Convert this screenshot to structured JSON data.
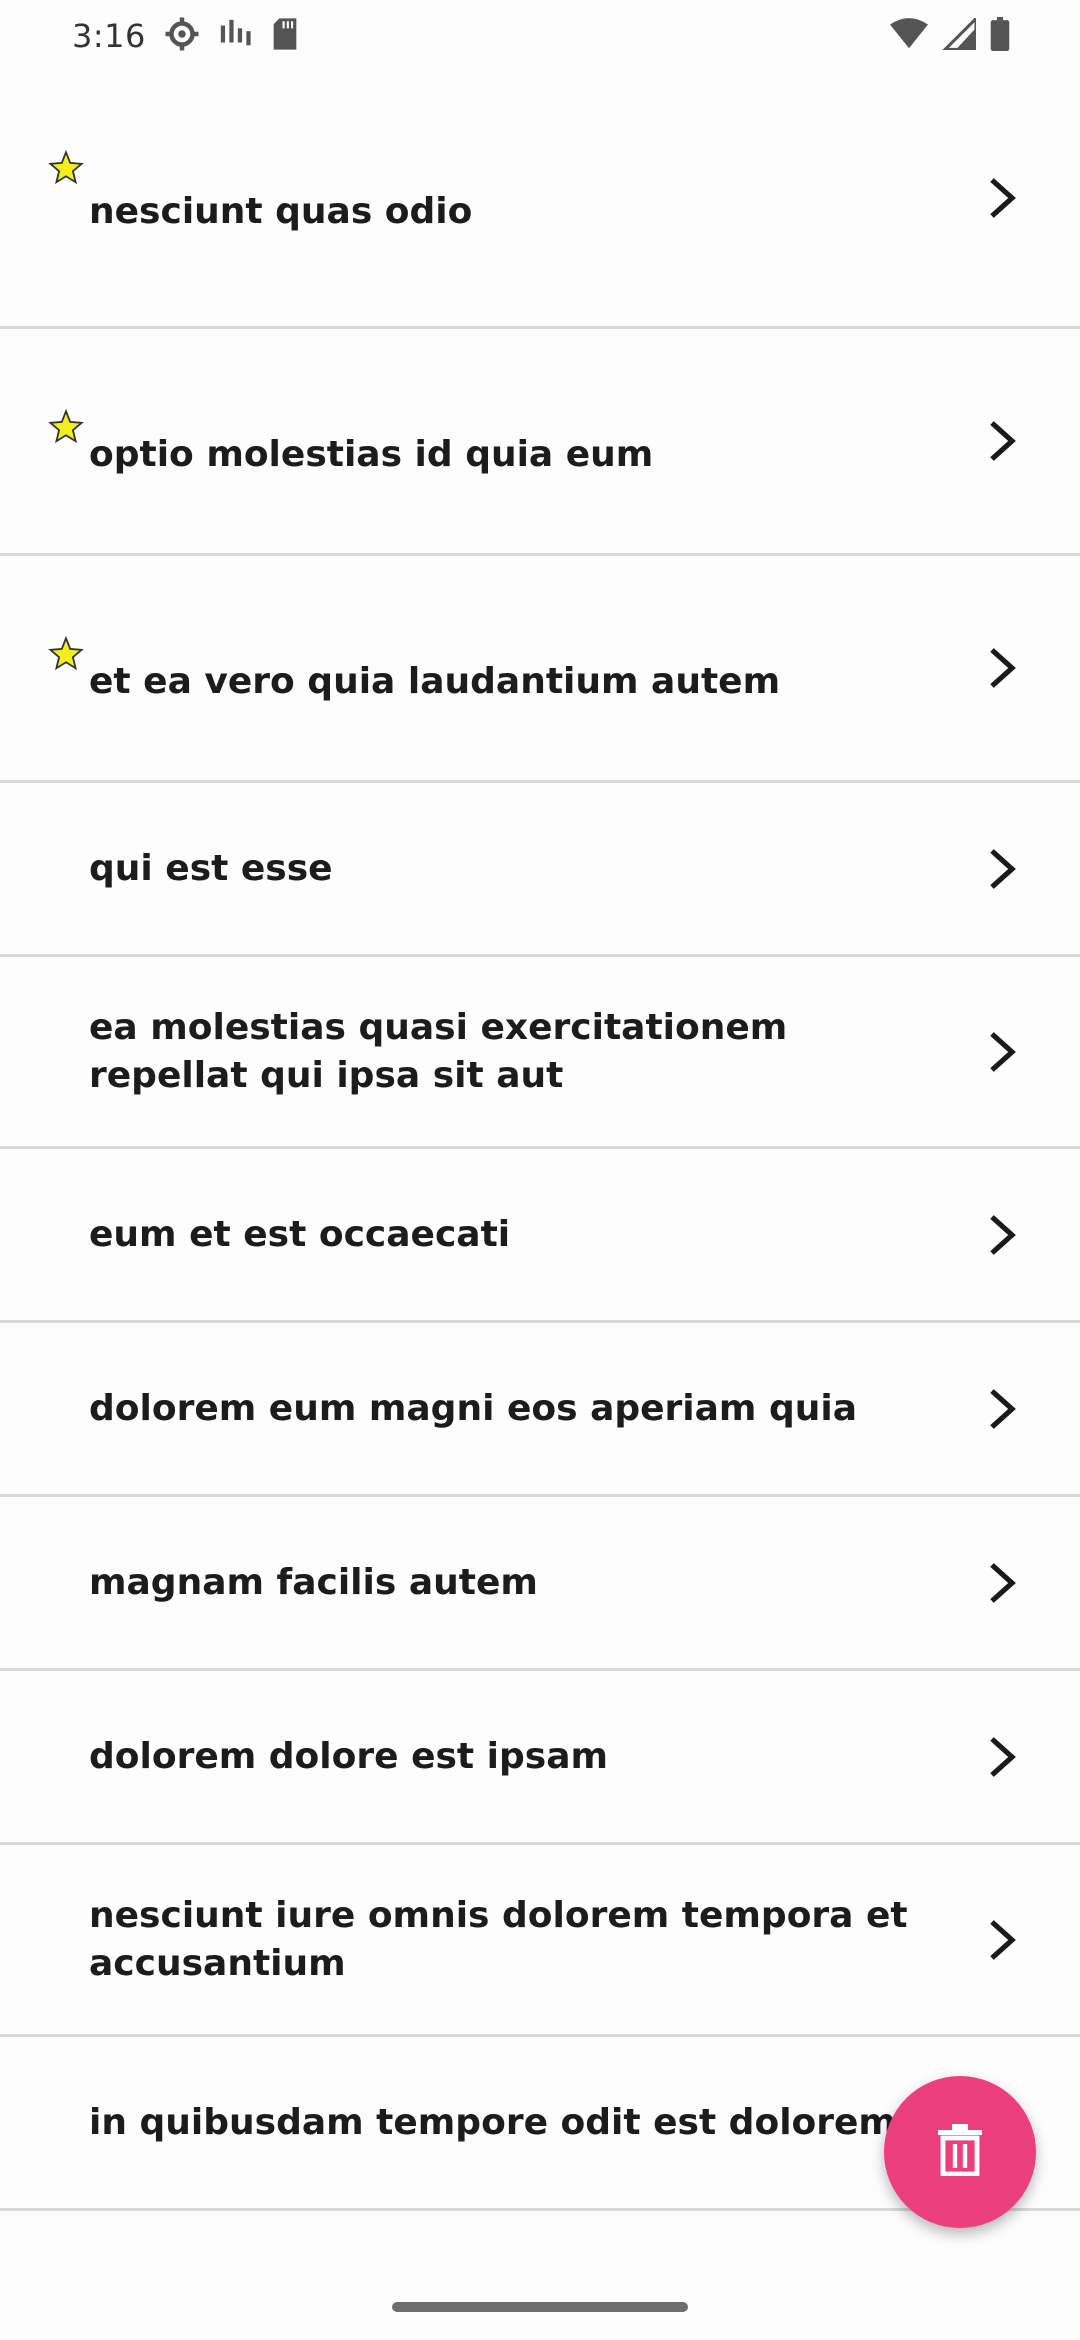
{
  "status_bar": {
    "time": "3:16",
    "icons_left": [
      "settings-icon",
      "signal-bars-icon",
      "sd-card-icon"
    ],
    "icons_right": [
      "wifi-icon",
      "cell-signal-icon",
      "battery-icon"
    ]
  },
  "list": {
    "items": [
      {
        "title": "nesciunt quas odio",
        "starred": true
      },
      {
        "title": "optio molestias id quia eum",
        "starred": true
      },
      {
        "title": "et ea vero quia laudantium autem",
        "starred": true
      },
      {
        "title": "qui est esse",
        "starred": false
      },
      {
        "title": "ea molestias quasi exercitationem repellat qui ipsa sit aut",
        "starred": false
      },
      {
        "title": "eum et est occaecati",
        "starred": false
      },
      {
        "title": "dolorem eum magni eos aperiam quia",
        "starred": false
      },
      {
        "title": "magnam facilis autem",
        "starred": false
      },
      {
        "title": "dolorem dolore est ipsam",
        "starred": false
      },
      {
        "title": "nesciunt iure omnis dolorem tempora et accusantium",
        "starred": false
      },
      {
        "title": "in quibusdam tempore odit est dolorem",
        "starred": false
      }
    ]
  },
  "fab": {
    "icon": "trash-icon",
    "color": "#ec3f7c"
  },
  "colors": {
    "star_fill": "#f5ee1f",
    "divider": "#d7d7d7"
  }
}
